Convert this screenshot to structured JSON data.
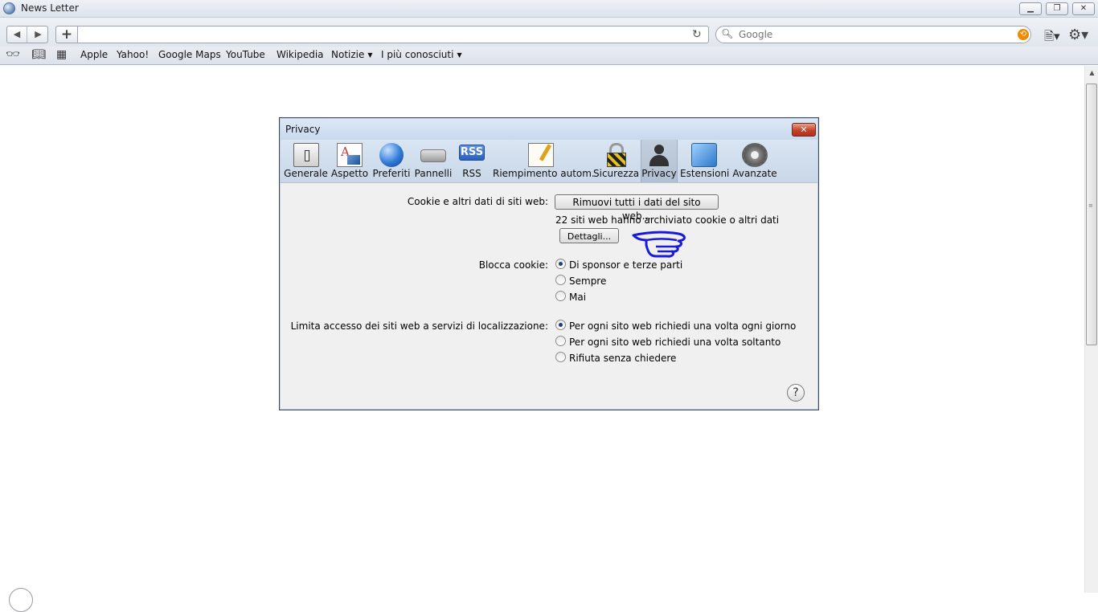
{
  "window": {
    "title": "News Letter",
    "min_glyph": "▁",
    "max_glyph": "❐",
    "close_glyph": "✕"
  },
  "toolbar": {
    "back_glyph": "◀",
    "forward_glyph": "▶",
    "add_glyph": "+",
    "address_value": "",
    "reload_glyph": "↻",
    "search_placeholder": "Google",
    "search_glyph": "🔍︎",
    "clear_glyph": "⟲",
    "page_menu_glyph": "🗎▾",
    "settings_glyph": "⚙▾"
  },
  "bookmarks": {
    "icons": {
      "reader": "👓︎",
      "book": "📖︎",
      "grid": "▦"
    },
    "items": [
      "Apple",
      "Yahoo!",
      "Google Maps",
      "YouTube",
      "Wikipedia"
    ],
    "menus": [
      "Notizie",
      "I più conosciuti"
    ],
    "caret": "▼"
  },
  "scrollbar": {
    "up_glyph": "▲",
    "grip_glyph": "≡"
  },
  "dialog": {
    "title": "Privacy",
    "close_glyph": "✕",
    "tabs": [
      "Generale",
      "Aspetto",
      "Preferiti",
      "Pannelli",
      "RSS",
      "Riempimento autom.",
      "Sicurezza",
      "Privacy",
      "Estensioni",
      "Avanzate"
    ],
    "rss_icon_text": "RSS",
    "active_tab": "Privacy",
    "cookies": {
      "label": "Cookie e altri dati di siti web:",
      "remove_button": "Rimuovi tutti i dati del sito web...",
      "count_text": "22 siti web hanno archiviato cookie o altri dati",
      "details_button": "Dettagli..."
    },
    "block_cookies": {
      "label": "Blocca cookie:",
      "options": [
        "Di sponsor e terze parti",
        "Sempre",
        "Mai"
      ],
      "selected": "Di sponsor e terze parti"
    },
    "location": {
      "label": "Limita accesso dei siti web a servizi di localizzazione:",
      "options": [
        "Per ogni sito web richiedi una volta ogni giorno",
        "Per ogni sito web richiedi una volta soltanto",
        "Rifiuta senza chiedere"
      ],
      "selected": "Per ogni sito web richiedi una volta ogni giorno"
    },
    "help_glyph": "?"
  },
  "colors": {
    "annotation_hand": "#1a1adb",
    "close_red": "#c4412a",
    "accent_blue": "#2f78c8"
  }
}
